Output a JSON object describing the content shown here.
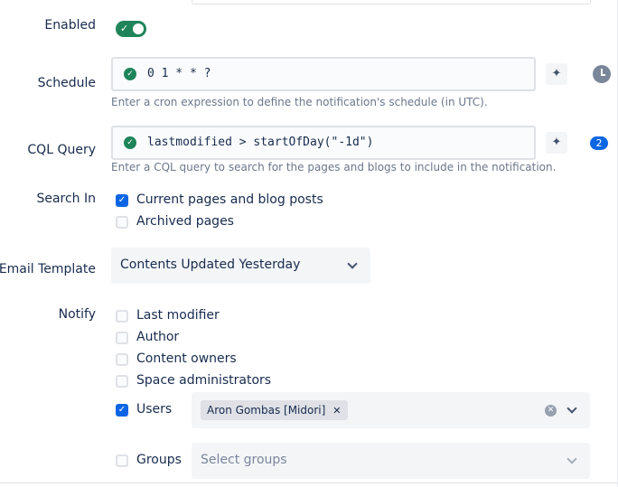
{
  "form": {
    "enabled": {
      "label": "Enabled",
      "checked": true
    },
    "schedule": {
      "label": "Schedule",
      "value": "0 1 * * ?",
      "help": "Enter a cron expression to define the notification's schedule (in UTC)."
    },
    "cql": {
      "label": "CQL Query",
      "value": "lastmodified > startOfDay(\"-1d\")",
      "help": "Enter a CQL query to search for the pages and blogs to include in the notification.",
      "count": "2"
    },
    "search_in": {
      "label": "Search In",
      "options": [
        {
          "label": "Current pages and blog posts",
          "checked": true
        },
        {
          "label": "Archived pages",
          "checked": false
        }
      ]
    },
    "email_template": {
      "label": "Email Template",
      "selected": "Contents Updated Yesterday"
    },
    "notify": {
      "label": "Notify",
      "options": [
        {
          "label": "Last modifier",
          "checked": false
        },
        {
          "label": "Author",
          "checked": false
        },
        {
          "label": "Content owners",
          "checked": false
        },
        {
          "label": "Space administrators",
          "checked": false
        },
        {
          "label": "Users",
          "checked": true
        },
        {
          "label": "Groups",
          "checked": false
        }
      ],
      "users_selected": [
        "Aron Gombas [Midori]"
      ],
      "groups_placeholder": "Select groups"
    }
  },
  "icons": {
    "valid": "check-circle-icon",
    "ai": "sparkle-icon",
    "history": "clock-icon",
    "dropdown": "chevron-down-icon",
    "clear": "clear-icon",
    "remove": "close-icon"
  },
  "colors": {
    "success": "#1f845a",
    "primary": "#0c66e4",
    "text": "#172b4d",
    "subtle": "#6b778c"
  }
}
